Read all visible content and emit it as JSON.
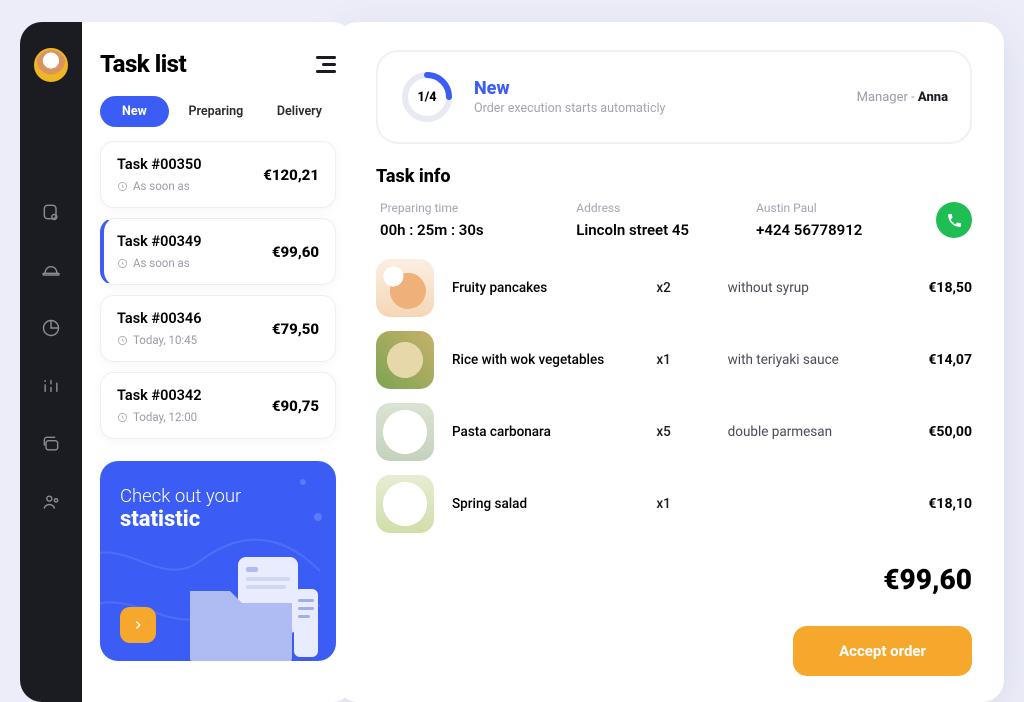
{
  "header": {
    "title": "Task list"
  },
  "tabs": [
    {
      "label": "New",
      "active": true
    },
    {
      "label": "Preparing",
      "active": false
    },
    {
      "label": "Delivery",
      "active": false
    }
  ],
  "tasks": [
    {
      "id": "Task #00350",
      "when": "As soon as",
      "price": "€120,21",
      "selected": false
    },
    {
      "id": "Task #00349",
      "when": "As soon as",
      "price": "€99,60",
      "selected": true
    },
    {
      "id": "Task #00346",
      "when": "Today, 10:45",
      "price": "€79,50",
      "selected": false
    },
    {
      "id": "Task #00342",
      "when": "Today, 12:00",
      "price": "€90,75",
      "selected": false
    }
  ],
  "promo": {
    "line1": "Check out your",
    "line2": "statistic"
  },
  "status": {
    "progress_text": "1/4",
    "progress_fraction": 0.25,
    "title": "New",
    "subtitle": "Order execution starts automaticly",
    "manager_label": "Manager - ",
    "manager_name": "Anna"
  },
  "info": {
    "title": "Task info",
    "col1_label": "Preparing time",
    "col1_value": "00h : 25m : 30s",
    "col2_label": "Address",
    "col2_value": "Lincoln street 45",
    "col3_label": "Austin Paul",
    "col3_value": "+424 56778912"
  },
  "items": [
    {
      "name": "Fruity pancakes",
      "qty": "x2",
      "mod": "without syrup",
      "price": "€18,50",
      "thumb": "th1"
    },
    {
      "name": "Rice with wok vegetables",
      "qty": "x1",
      "mod": "with teriyaki sauce",
      "price": "€14,07",
      "thumb": "th2"
    },
    {
      "name": "Pasta carbonara",
      "qty": "x5",
      "mod": "double parmesan",
      "price": "€50,00",
      "thumb": "th3"
    },
    {
      "name": "Spring salad",
      "qty": "x1",
      "mod": "",
      "price": "€18,10",
      "thumb": "th4"
    }
  ],
  "total": "€99,60",
  "accept_label": "Accept order"
}
